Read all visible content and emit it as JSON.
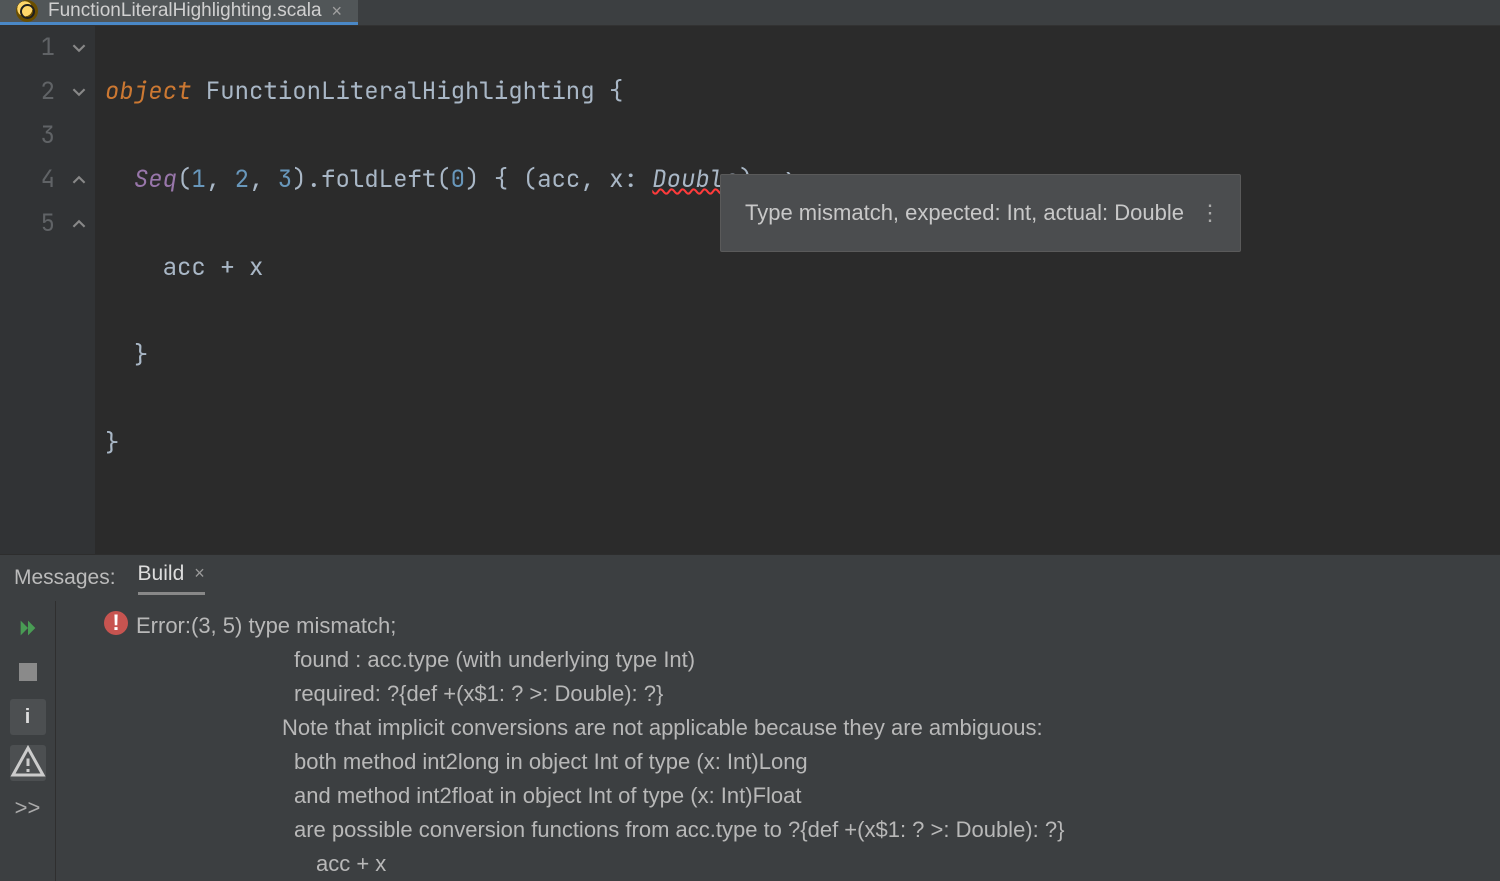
{
  "tab": {
    "filename": "FunctionLiteralHighlighting.scala"
  },
  "editor": {
    "lines": [
      "1",
      "2",
      "3",
      "4",
      "5"
    ],
    "kw_object": "object",
    "cls_name": "FunctionLiteralHighlighting",
    "brace_open": " {",
    "seq": "Seq",
    "lp": "(",
    "n1": "1",
    "comma": ", ",
    "n2": "2",
    "n3": "3",
    "rp": ")",
    "dot_fold": ".foldLeft(",
    "n0": "0",
    "close_start": ") { (acc, x: ",
    "double": "Double",
    "after_double": ") =>",
    "line3": "acc + x",
    "line4": "}",
    "line5": "}"
  },
  "tooltip": {
    "text": "Type mismatch, expected: Int, actual: Double",
    "more": "⋮"
  },
  "panel": {
    "label": "Messages:",
    "tab": "Build"
  },
  "error": {
    "icon": "!",
    "head": "Error:(3, 5)  type mismatch;",
    "l2": " found   : acc.type (with underlying type Int)",
    "l3": " required: ?{def +(x$1: ? >: Double): ?}",
    "l4": "Note that implicit conversions are not applicable because they are ambiguous:",
    "l5": " both method int2long in object Int of type (x: Int)Long",
    "l6": " and method int2float in object Int of type (x: Int)Float",
    "l7": " are possible conversion functions from acc.type to ?{def +(x$1: ? >: Double): ?}",
    "l8": "   acc + x"
  },
  "side": {
    "chev": ">>"
  }
}
